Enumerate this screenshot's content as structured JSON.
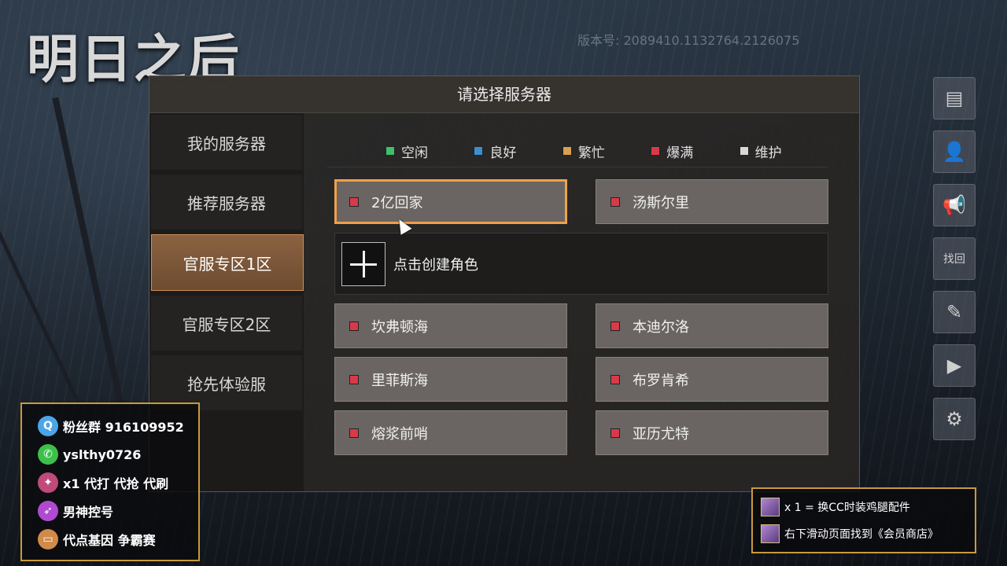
{
  "game": {
    "logo": "明日之后",
    "version": "版本号: 2089410.1132764.2126075"
  },
  "panel": {
    "title": "请选择服务器"
  },
  "tabs": [
    {
      "label": "我的服务器",
      "active": false
    },
    {
      "label": "推荐服务器",
      "active": false
    },
    {
      "label": "官服专区1区",
      "active": true
    },
    {
      "label": "官服专区2区",
      "active": false
    },
    {
      "label": "抢先体验服",
      "active": false
    }
  ],
  "legend": [
    {
      "label": "空闲",
      "color": "#3fbf6a"
    },
    {
      "label": "良好",
      "color": "#3a8fd0"
    },
    {
      "label": "繁忙",
      "color": "#d9a050"
    },
    {
      "label": "爆满",
      "color": "#d83a4a"
    },
    {
      "label": "维护",
      "color": "#d8d8d8"
    }
  ],
  "servers_top": [
    {
      "name": "2亿回家",
      "status_color": "#d83a4a",
      "selected": true
    },
    {
      "name": "汤斯尔里",
      "status_color": "#d83a4a",
      "selected": false
    }
  ],
  "create_role": {
    "label": "点击创建角色"
  },
  "servers": [
    {
      "name": "坎弗顿海",
      "status_color": "#d83a4a"
    },
    {
      "name": "本迪尔洛",
      "status_color": "#d83a4a"
    },
    {
      "name": "里菲斯海",
      "status_color": "#d83a4a"
    },
    {
      "name": "布罗肯希",
      "status_color": "#d83a4a"
    },
    {
      "name": "熔浆前哨",
      "status_color": "#d83a4a"
    },
    {
      "name": "亚历尤特",
      "status_color": "#d83a4a"
    }
  ],
  "right_icons": [
    {
      "name": "notice-icon",
      "glyph": "▤"
    },
    {
      "name": "account-icon",
      "glyph": "👤"
    },
    {
      "name": "announce-icon",
      "glyph": "📢"
    },
    {
      "name": "retrieve-icon",
      "glyph": "找回"
    },
    {
      "name": "survey-icon",
      "glyph": "✎"
    },
    {
      "name": "video-icon",
      "glyph": "▶"
    },
    {
      "name": "user-settings-icon",
      "glyph": "⚙"
    }
  ],
  "streamer": {
    "lines": [
      {
        "icon": "qq-icon",
        "glyph": "Q",
        "color": "#4aa6e8",
        "text": "粉丝群 916109952"
      },
      {
        "icon": "wechat-icon",
        "glyph": "✆",
        "color": "#3cc04a",
        "text": "yslthy0726"
      },
      {
        "icon": "figure-icon",
        "glyph": "✦",
        "color": "#c04a7a",
        "text": "x1 代打 代抢 代刷"
      },
      {
        "icon": "rocket-icon",
        "glyph": "➶",
        "color": "#b04ad0",
        "text": "男神控号"
      },
      {
        "icon": "card-icon",
        "glyph": "▭",
        "color": "#d08a4a",
        "text": "代点基因 争霸赛"
      }
    ]
  },
  "promo": {
    "lines": [
      {
        "text": "x 1 = 换CC时装鸡腿配件"
      },
      {
        "text": "右下滑动页面找到《会员商店》"
      }
    ]
  }
}
